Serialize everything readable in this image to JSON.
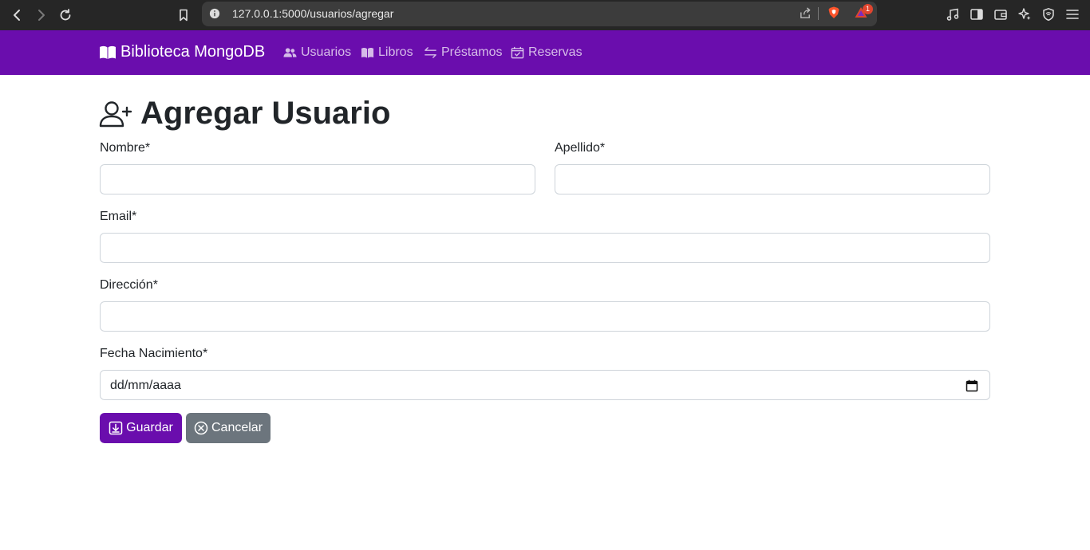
{
  "browser": {
    "url": "127.0.0.1:5000/usuarios/agregar",
    "notification_count": "1"
  },
  "navbar": {
    "brand": "Biblioteca MongoDB",
    "items": [
      {
        "label": "Usuarios",
        "icon": "users-icon"
      },
      {
        "label": "Libros",
        "icon": "book-icon"
      },
      {
        "label": "Préstamos",
        "icon": "arrows-exchange-icon"
      },
      {
        "label": "Reservas",
        "icon": "calendar-check-icon"
      }
    ],
    "background": "#6a0dad"
  },
  "page": {
    "title": "Agregar Usuario"
  },
  "form": {
    "nombre_label": "Nombre*",
    "nombre_value": "",
    "apellido_label": "Apellido*",
    "apellido_value": "",
    "email_label": "Email*",
    "email_value": "",
    "direccion_label": "Dirección*",
    "direccion_value": "",
    "fecha_label": "Fecha Nacimiento*",
    "fecha_placeholder": "dd/mm/aaaa"
  },
  "buttons": {
    "save_label": "Guardar",
    "cancel_label": "Cancelar",
    "primary_color": "#6a0dad",
    "secondary_color": "#6c757d"
  }
}
